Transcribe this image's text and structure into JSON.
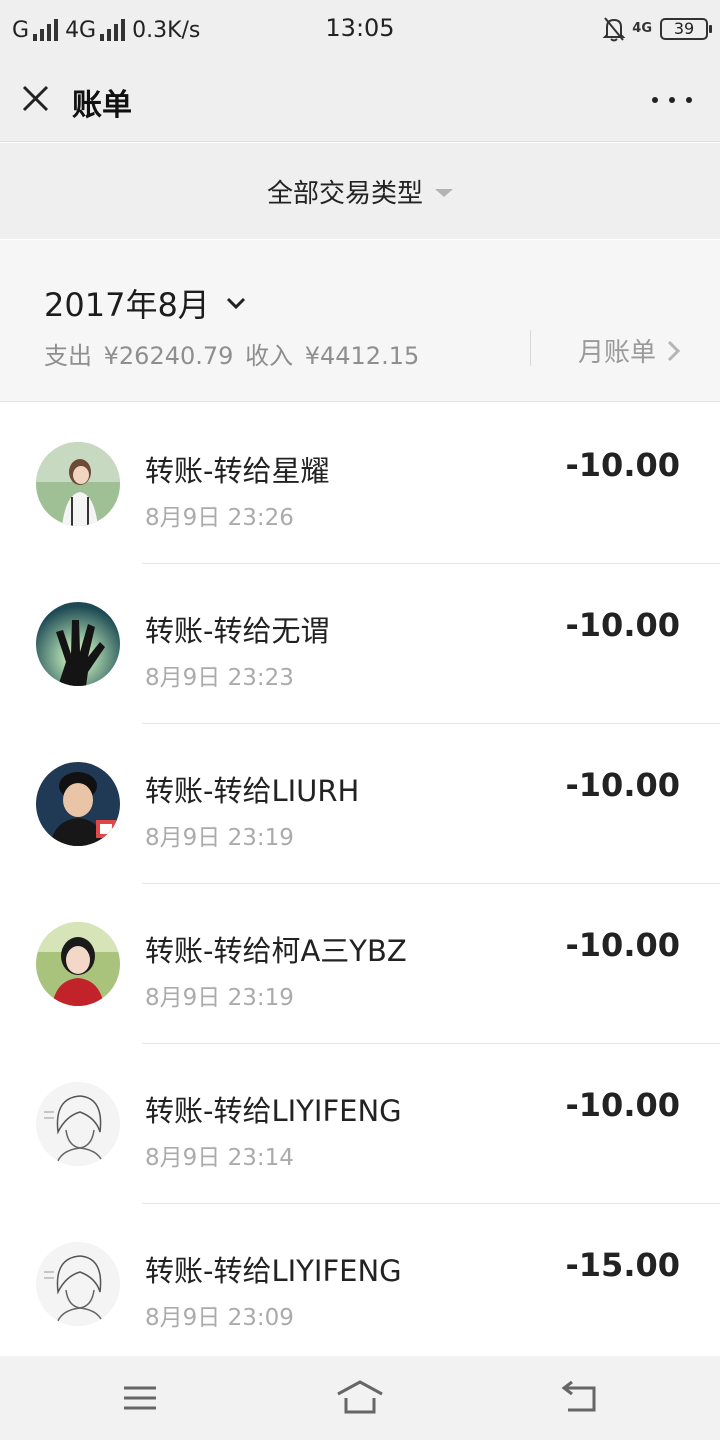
{
  "status_bar": {
    "signal_1": "G",
    "signal_2": "4G",
    "speed": "0.3K/s",
    "time": "13:05",
    "network_right": "4G",
    "battery": "39"
  },
  "header": {
    "title": "账单"
  },
  "filter": {
    "label": "全部交易类型"
  },
  "month": {
    "label": "2017年8月",
    "expense_label": "支出",
    "expense_value": "¥26240.79",
    "income_label": "收入",
    "income_value": "¥4412.15",
    "monthly_bill": "月账单"
  },
  "transactions": [
    {
      "title": "转账-转给星耀",
      "time": "8月9日 23:26",
      "amount": "-10.00"
    },
    {
      "title": "转账-转给无谓",
      "time": "8月9日 23:23",
      "amount": "-10.00"
    },
    {
      "title": "转账-转给LIURH",
      "time": "8月9日 23:19",
      "amount": "-10.00"
    },
    {
      "title": "转账-转给柯A三YBZ",
      "time": "8月9日 23:19",
      "amount": "-10.00"
    },
    {
      "title": "转账-转给LIYIFENG",
      "time": "8月9日 23:14",
      "amount": "-10.00"
    },
    {
      "title": "转账-转给LIYIFENG",
      "time": "8月9日 23:09",
      "amount": "-15.00"
    }
  ],
  "icons": {
    "close": "close-icon",
    "more": "more-icon",
    "caret": "caret-down-icon",
    "chevron": "chevron-right-icon",
    "nav_menu": "menu-icon",
    "nav_home": "home-icon",
    "nav_back": "back-icon"
  }
}
